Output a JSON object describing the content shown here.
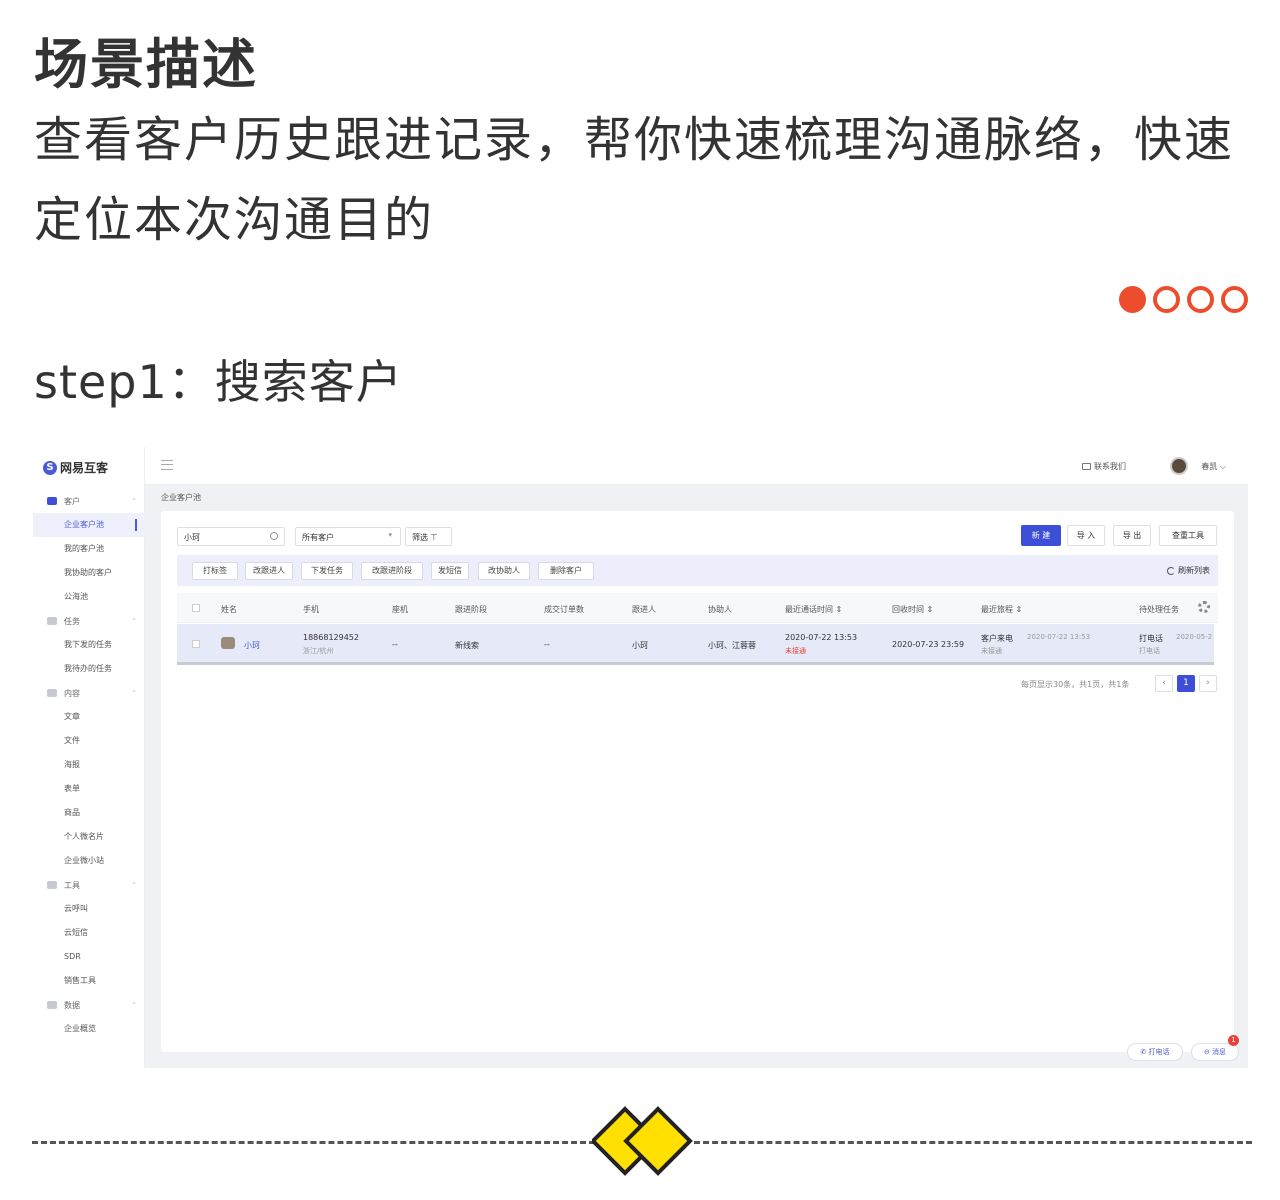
{
  "article": {
    "title": "场景描述",
    "description": "查看客户历史跟进记录，帮你快速梳理沟通脉络，快速定位本次沟通目的",
    "step_title": "step1：搜索客户"
  },
  "colors": {
    "accent": "#ec4e2d",
    "brand": "#3d4fd6",
    "alert": "#e8423a"
  },
  "app": {
    "logo": "网易互客",
    "topbar": {
      "contact": "联系我们",
      "user": "春凯 ⌵"
    },
    "sidebar": [
      {
        "label": "客户",
        "icon": "customer-icon",
        "type": "group"
      },
      {
        "label": "企业客户池",
        "type": "item",
        "active": true
      },
      {
        "label": "我的客户池",
        "type": "item"
      },
      {
        "label": "我协助的客户",
        "type": "item"
      },
      {
        "label": "公海池",
        "type": "item"
      },
      {
        "label": "任务",
        "icon": "task-icon",
        "type": "group"
      },
      {
        "label": "我下发的任务",
        "type": "item"
      },
      {
        "label": "我待办的任务",
        "type": "item"
      },
      {
        "label": "内容",
        "icon": "content-icon",
        "type": "group"
      },
      {
        "label": "文章",
        "type": "item"
      },
      {
        "label": "文件",
        "type": "item"
      },
      {
        "label": "海报",
        "type": "item"
      },
      {
        "label": "表单",
        "type": "item"
      },
      {
        "label": "商品",
        "type": "item"
      },
      {
        "label": "个人微名片",
        "type": "item"
      },
      {
        "label": "企业微小站",
        "type": "item"
      },
      {
        "label": "工具",
        "icon": "tool-icon",
        "type": "group"
      },
      {
        "label": "云呼叫",
        "type": "item"
      },
      {
        "label": "云短信",
        "type": "item"
      },
      {
        "label": "SDR",
        "type": "item"
      },
      {
        "label": "销售工具",
        "type": "item"
      },
      {
        "label": "数据",
        "icon": "data-icon",
        "type": "group"
      },
      {
        "label": "企业概览",
        "type": "item"
      }
    ],
    "breadcrumb": "企业客户池",
    "toolbar": {
      "search_value": "小珂",
      "select_value": "所有客户",
      "filter_label": "筛选 ⊤",
      "new_label": "新 建",
      "import_label": "导 入",
      "export_label": "导 出",
      "dedupe_label": "查重工具"
    },
    "actions": [
      "打标签",
      "改跟进人",
      "下发任务",
      "改跟进阶段",
      "发短信",
      "改协助人",
      "删除客户"
    ],
    "refresh_label": "刷新列表",
    "columns": [
      "姓名",
      "手机",
      "座机",
      "跟进阶段",
      "成交订单数",
      "跟进人",
      "协助人",
      "最近通话时间 ⇕",
      "回收时间 ⇕",
      "最近旅程 ⇕",
      "待处理任务"
    ],
    "row": {
      "name": "小珂",
      "phone": "18868129452",
      "region": "浙江/杭州",
      "landline": "--",
      "stage": "新线索",
      "orders": "--",
      "follower": "小珂",
      "assistants": "小珂、江蓉蓉",
      "last_call": "2020-07-22 13:53",
      "last_call_status": "未接通",
      "recycle_time": "2020-07-23 23:59",
      "journey": "客户来电",
      "journey_time": "2020-07-22 13:53",
      "journey_status": "未接通",
      "task": "打电话",
      "task_time": "2020-05-2",
      "task_sub": "打电话"
    },
    "pagination": {
      "summary": "每页显示30条，共1页，共1条",
      "prev": "‹",
      "page": "1",
      "next": "›"
    },
    "floating": {
      "call": "✆ 打电话",
      "message": "⊖ 消息",
      "badge": "1"
    }
  }
}
